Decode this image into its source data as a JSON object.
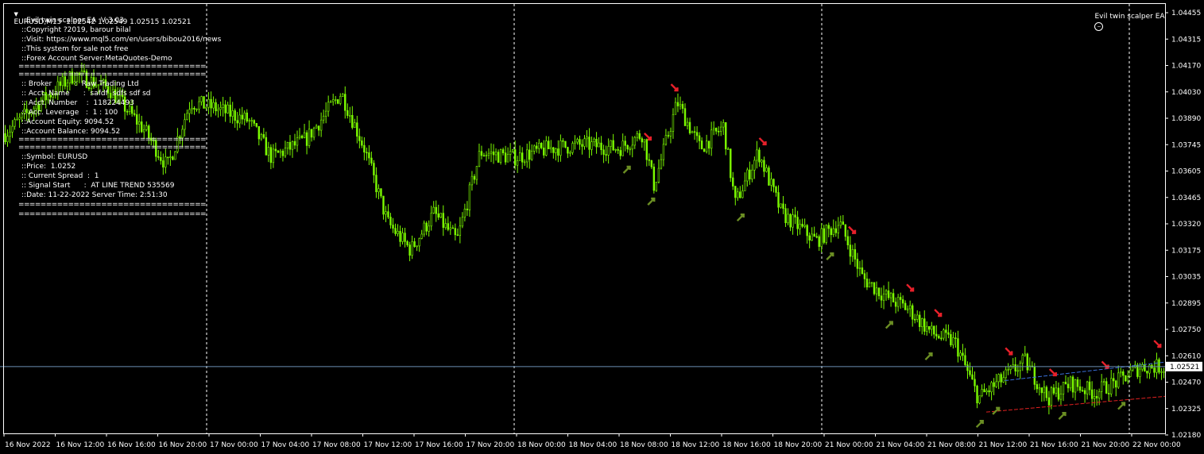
{
  "header": {
    "symbol_line": "EURUSD,M15  1.02542 1.02549 1.02515 1.02521",
    "ea_label": "Evil twin scalper EA"
  },
  "info_panel": {
    "lines_a": [
      "::Evil twin scalper EA  V 3.03",
      "::Copyright ?2019, barour bilal",
      "::Visit: https://www.mql5.com/en/users/bibou2016/news",
      "::This system for sale not free",
      "::Forex Account Server:MetaQuotes-Demo"
    ],
    "separator": "==================================",
    "lines_b": [
      ":: Broker          :  Raw Trading Ltd",
      ":: Acct. Name      :  safdf  sdfs sdf sd",
      ":: Acct. Number    :  118224493",
      ":: Acc. Leverage   :  1 : 100",
      "::Account Equity: 9094.52",
      "::Account Balance: 9094.52"
    ],
    "lines_c": [
      "::Symbol: EURUSD",
      "::Price:  1.0252",
      ":: Current Spread  :  1",
      ":: Signal Start      :  AT LINE TREND 535569",
      "::Date: 11-22-2022 Server Time: 2:51:30"
    ]
  },
  "price_axis": {
    "labels": [
      "1.04455",
      "1.04315",
      "1.04170",
      "1.04030",
      "1.03890",
      "1.03745",
      "1.03605",
      "1.03465",
      "1.03320",
      "1.03175",
      "1.03035",
      "1.02895",
      "1.02750",
      "1.02610",
      "1.02470",
      "1.02325",
      "1.02180"
    ],
    "current_price": "1.02521"
  },
  "time_axis": {
    "labels": [
      "16 Nov 2022",
      "16 Nov 12:00",
      "16 Nov 16:00",
      "16 Nov 20:00",
      "17 Nov 00:00",
      "17 Nov 04:00",
      "17 Nov 08:00",
      "17 Nov 12:00",
      "17 Nov 16:00",
      "17 Nov 20:00",
      "18 Nov 00:00",
      "18 Nov 04:00",
      "18 Nov 08:00",
      "18 Nov 12:00",
      "18 Nov 16:00",
      "18 Nov 20:00",
      "21 Nov 00:00",
      "21 Nov 04:00",
      "21 Nov 08:00",
      "21 Nov 12:00",
      "21 Nov 16:00",
      "21 Nov 20:00",
      "22 Nov 00:00"
    ]
  },
  "colors": {
    "background": "#000000",
    "candles": "#7cfc00",
    "grid_text": "#ffffff",
    "price_line": "#6b8eb3",
    "sell_arrow": "#e8202a",
    "buy_arrow": "#6b8e23",
    "resistance_line": "#3a6fd8",
    "support_line": "#e02020"
  },
  "chart_data": {
    "type": "candlestick",
    "symbol": "EURUSD",
    "timeframe": "M15",
    "ylim": [
      1.0216,
      1.0448
    ],
    "current_price": 1.02521,
    "day_separators": [
      "17 Nov 00:00",
      "18 Nov 00:00",
      "21 Nov 00:00",
      "22 Nov 00:00"
    ],
    "close_path": [
      {
        "t": 0,
        "p": 1.0378
      },
      {
        "t": 0.03,
        "p": 1.0395
      },
      {
        "t": 0.06,
        "p": 1.041
      },
      {
        "t": 0.09,
        "p": 1.0402
      },
      {
        "t": 0.12,
        "p": 1.038
      },
      {
        "t": 0.14,
        "p": 1.036
      },
      {
        "t": 0.16,
        "p": 1.0395
      },
      {
        "t": 0.18,
        "p": 1.0392
      },
      {
        "t": 0.21,
        "p": 1.0385
      },
      {
        "t": 0.23,
        "p": 1.0365
      },
      {
        "t": 0.26,
        "p": 1.0375
      },
      {
        "t": 0.29,
        "p": 1.04
      },
      {
        "t": 0.31,
        "p": 1.037
      },
      {
        "t": 0.33,
        "p": 1.033
      },
      {
        "t": 0.35,
        "p": 1.0315
      },
      {
        "t": 0.37,
        "p": 1.0335
      },
      {
        "t": 0.39,
        "p": 1.032
      },
      {
        "t": 0.41,
        "p": 1.0368
      },
      {
        "t": 0.44,
        "p": 1.0365
      },
      {
        "t": 0.47,
        "p": 1.037
      },
      {
        "t": 0.5,
        "p": 1.0372
      },
      {
        "t": 0.53,
        "p": 1.037
      },
      {
        "t": 0.55,
        "p": 1.0378
      },
      {
        "t": 0.56,
        "p": 1.035
      },
      {
        "t": 0.58,
        "p": 1.0395
      },
      {
        "t": 0.6,
        "p": 1.037
      },
      {
        "t": 0.62,
        "p": 1.0382
      },
      {
        "t": 0.63,
        "p": 1.034
      },
      {
        "t": 0.65,
        "p": 1.0368
      },
      {
        "t": 0.67,
        "p": 1.0335
      },
      {
        "t": 0.7,
        "p": 1.032
      },
      {
        "t": 0.72,
        "p": 1.033
      },
      {
        "t": 0.74,
        "p": 1.03
      },
      {
        "t": 0.76,
        "p": 1.029
      },
      {
        "t": 0.78,
        "p": 1.0283
      },
      {
        "t": 0.8,
        "p": 1.027
      },
      {
        "t": 0.82,
        "p": 1.0265
      },
      {
        "t": 0.84,
        "p": 1.0235
      },
      {
        "t": 0.86,
        "p": 1.0245
      },
      {
        "t": 0.88,
        "p": 1.0255
      },
      {
        "t": 0.9,
        "p": 1.0235
      },
      {
        "t": 0.92,
        "p": 1.0243
      },
      {
        "t": 0.94,
        "p": 1.0238
      },
      {
        "t": 0.96,
        "p": 1.0244
      },
      {
        "t": 0.98,
        "p": 1.0252
      },
      {
        "t": 1.0,
        "p": 1.0252
      }
    ],
    "sell_signals": [
      0.555,
      0.578,
      0.654,
      0.731,
      0.781,
      0.805,
      0.866,
      0.904,
      0.949,
      0.994
    ],
    "buy_signals": [
      0.537,
      0.558,
      0.635,
      0.712,
      0.763,
      0.797,
      0.841,
      0.855,
      0.912,
      0.963
    ],
    "trend_lines": [
      {
        "name": "upper",
        "from": {
          "t": 0.862,
          "p": 1.02445
        },
        "to": {
          "t": 1.0,
          "p": 1.02545
        }
      },
      {
        "name": "lower",
        "from": {
          "t": 0.846,
          "p": 1.02275
        },
        "to": {
          "t": 1.0,
          "p": 1.0236
        }
      }
    ]
  }
}
